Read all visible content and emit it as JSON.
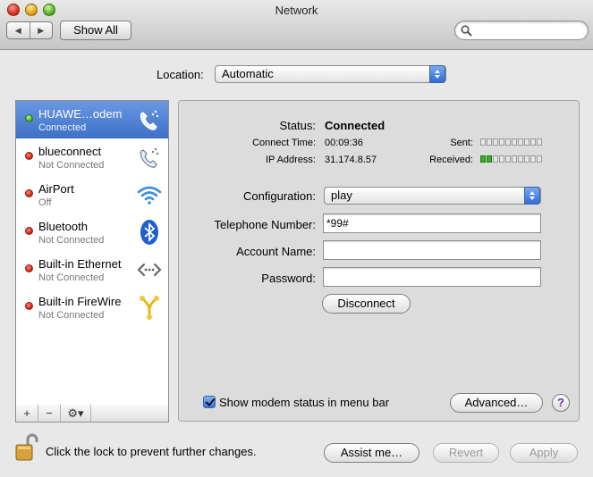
{
  "window": {
    "title": "Network"
  },
  "toolbar": {
    "back": "◀",
    "forward": "▶",
    "show_all": "Show All",
    "search_value": ""
  },
  "location": {
    "label": "Location:",
    "value": "Automatic"
  },
  "services": [
    {
      "name": "HUAWE…odem",
      "status": "Connected",
      "state": "green",
      "icon": "phone-modem-icon",
      "selected": true
    },
    {
      "name": "blueconnect",
      "status": "Not Connected",
      "state": "red",
      "icon": "phone-modem-icon",
      "selected": false
    },
    {
      "name": "AirPort",
      "status": "Off",
      "state": "red",
      "icon": "wifi-icon",
      "selected": false
    },
    {
      "name": "Bluetooth",
      "status": "Not Connected",
      "state": "red",
      "icon": "bluetooth-icon",
      "selected": false
    },
    {
      "name": "Built-in Ethernet",
      "status": "Not Connected",
      "state": "red",
      "icon": "ethernet-icon",
      "selected": false
    },
    {
      "name": "Built-in FireWire",
      "status": "Not Connected",
      "state": "red",
      "icon": "firewire-icon",
      "selected": false
    }
  ],
  "list_buttons": {
    "add": "+",
    "remove": "−",
    "gear": "⚙▾"
  },
  "details": {
    "status_label": "Status:",
    "status_value": "Connected",
    "connect_time_label": "Connect Time:",
    "connect_time_value": "00:09:36",
    "ip_label": "IP Address:",
    "ip_value": "31.174.8.57",
    "sent_label": "Sent:",
    "received_label": "Received:",
    "sent_level": 0,
    "received_level": 2,
    "meter_segments": 10,
    "configuration_label": "Configuration:",
    "configuration_value": "play",
    "phone_label": "Telephone Number:",
    "phone_value": "*99#",
    "account_label": "Account Name:",
    "account_value": "",
    "password_label": "Password:",
    "password_value": "",
    "disconnect_button": "Disconnect",
    "show_status_label": "Show modem status in menu bar",
    "advanced_button": "Advanced…",
    "help_button": "?"
  },
  "footer": {
    "lock_text": "Click the lock to prevent further changes.",
    "assist_button": "Assist me…",
    "revert_button": "Revert",
    "apply_button": "Apply"
  },
  "colors": {
    "selection": "#3d70c6",
    "connected": "#38a81a",
    "disconnected": "#d3200f"
  }
}
